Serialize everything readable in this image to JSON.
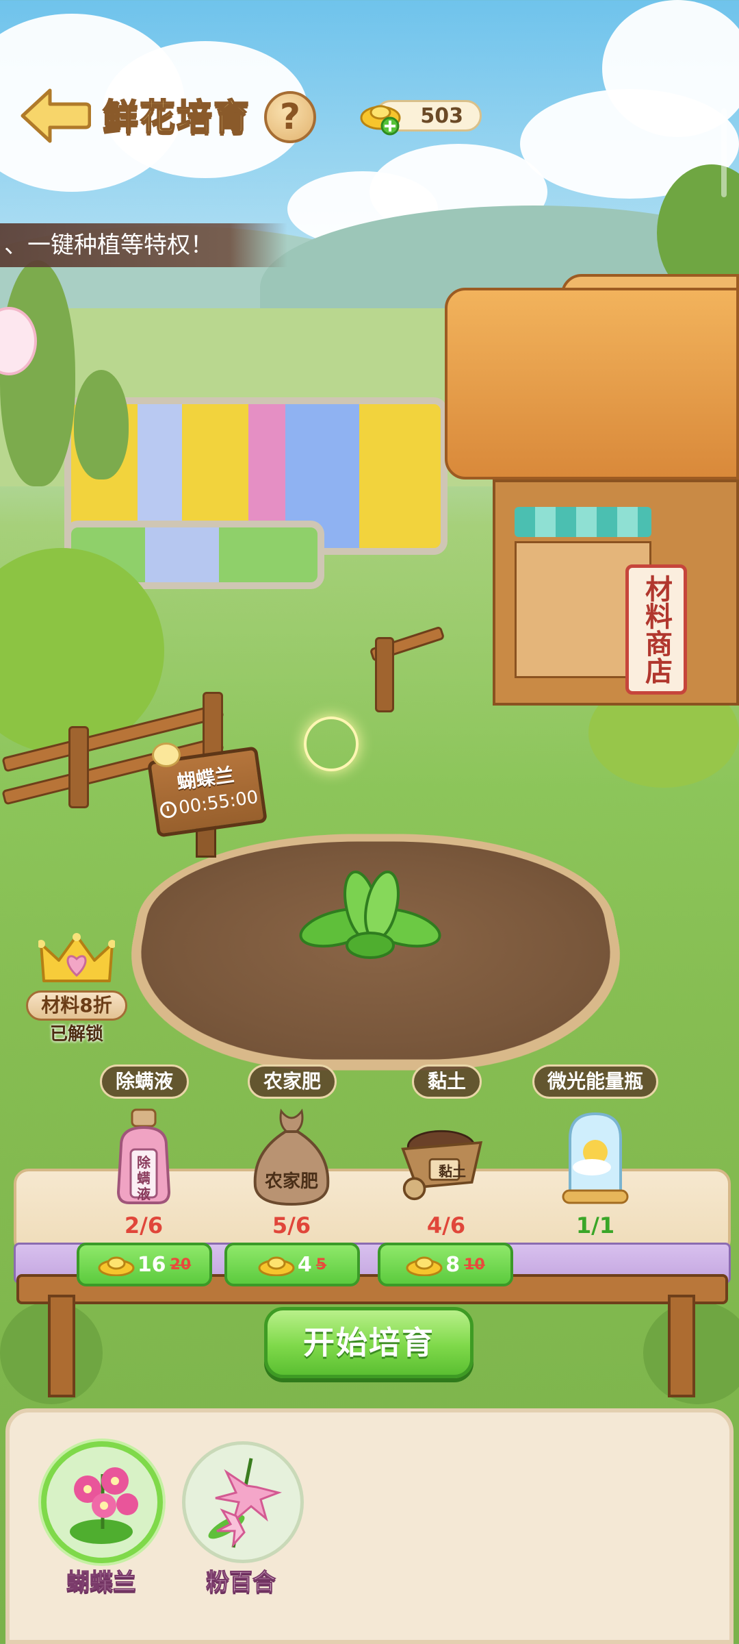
{
  "header": {
    "title": "鲜花培育",
    "help_label": "?",
    "coins": "503"
  },
  "banner": {
    "text": "、一键种植等特权！"
  },
  "shop": {
    "sign": "材料商店"
  },
  "growing": {
    "flower_name": "蝴蝶兰",
    "timer": "00:55:00"
  },
  "vip": {
    "label": "材料8折",
    "state": "已解锁"
  },
  "materials": [
    {
      "name": "除螨液",
      "icon_text": "除螨液",
      "count": "2/6",
      "price": "16",
      "old_price": "20",
      "count_color": "#e0463a"
    },
    {
      "name": "农家肥",
      "icon_text": "农家肥",
      "count": "5/6",
      "price": "4",
      "old_price": "5",
      "count_color": "#e0463a"
    },
    {
      "name": "黏土",
      "icon_text": "黏土",
      "count": "4/6",
      "price": "8",
      "old_price": "10",
      "count_color": "#e0463a"
    },
    {
      "name": "微光能量瓶",
      "count": "1/1",
      "count_color": "#3aa628"
    }
  ],
  "actions": {
    "start": "开始培育"
  },
  "flowers": [
    {
      "name": "蝴蝶兰",
      "selected": true
    },
    {
      "name": "粉百合",
      "selected": false
    }
  ],
  "colors": {
    "accent_green": "#7fd94a",
    "title_gold": "#f6d88a",
    "wood_brown": "#8a5a2a",
    "deficit_red": "#e0463a"
  }
}
